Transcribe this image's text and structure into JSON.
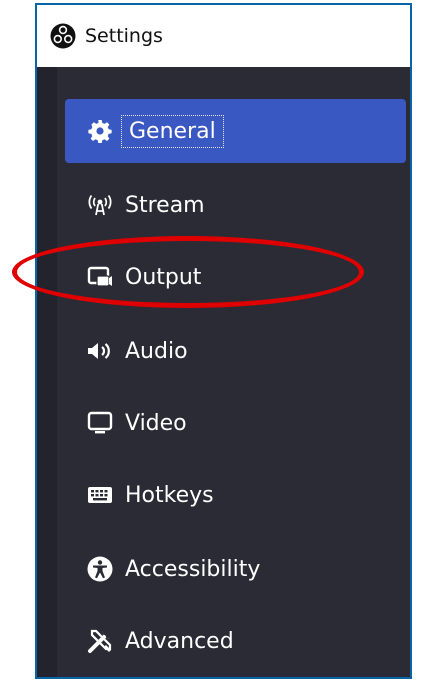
{
  "window": {
    "title": "Settings",
    "title_icon": "obs-logo-icon"
  },
  "sidebar": {
    "items": [
      {
        "label": "General",
        "icon": "gear-icon",
        "active": true
      },
      {
        "label": "Stream",
        "icon": "antenna-icon",
        "active": false
      },
      {
        "label": "Output",
        "icon": "output-icon",
        "active": false
      },
      {
        "label": "Audio",
        "icon": "speaker-icon",
        "active": false
      },
      {
        "label": "Video",
        "icon": "monitor-icon",
        "active": false
      },
      {
        "label": "Hotkeys",
        "icon": "keyboard-icon",
        "active": false
      },
      {
        "label": "Accessibility",
        "icon": "accessibility-icon",
        "active": false
      },
      {
        "label": "Advanced",
        "icon": "tools-icon",
        "active": false
      }
    ]
  },
  "annotation": {
    "highlighted_item": "Output",
    "color": "#e00000"
  },
  "colors": {
    "sidebar_bg": "#2a2b35",
    "active_bg": "#3a58c2",
    "text": "#ffffff",
    "window_border": "#0a64a8"
  }
}
